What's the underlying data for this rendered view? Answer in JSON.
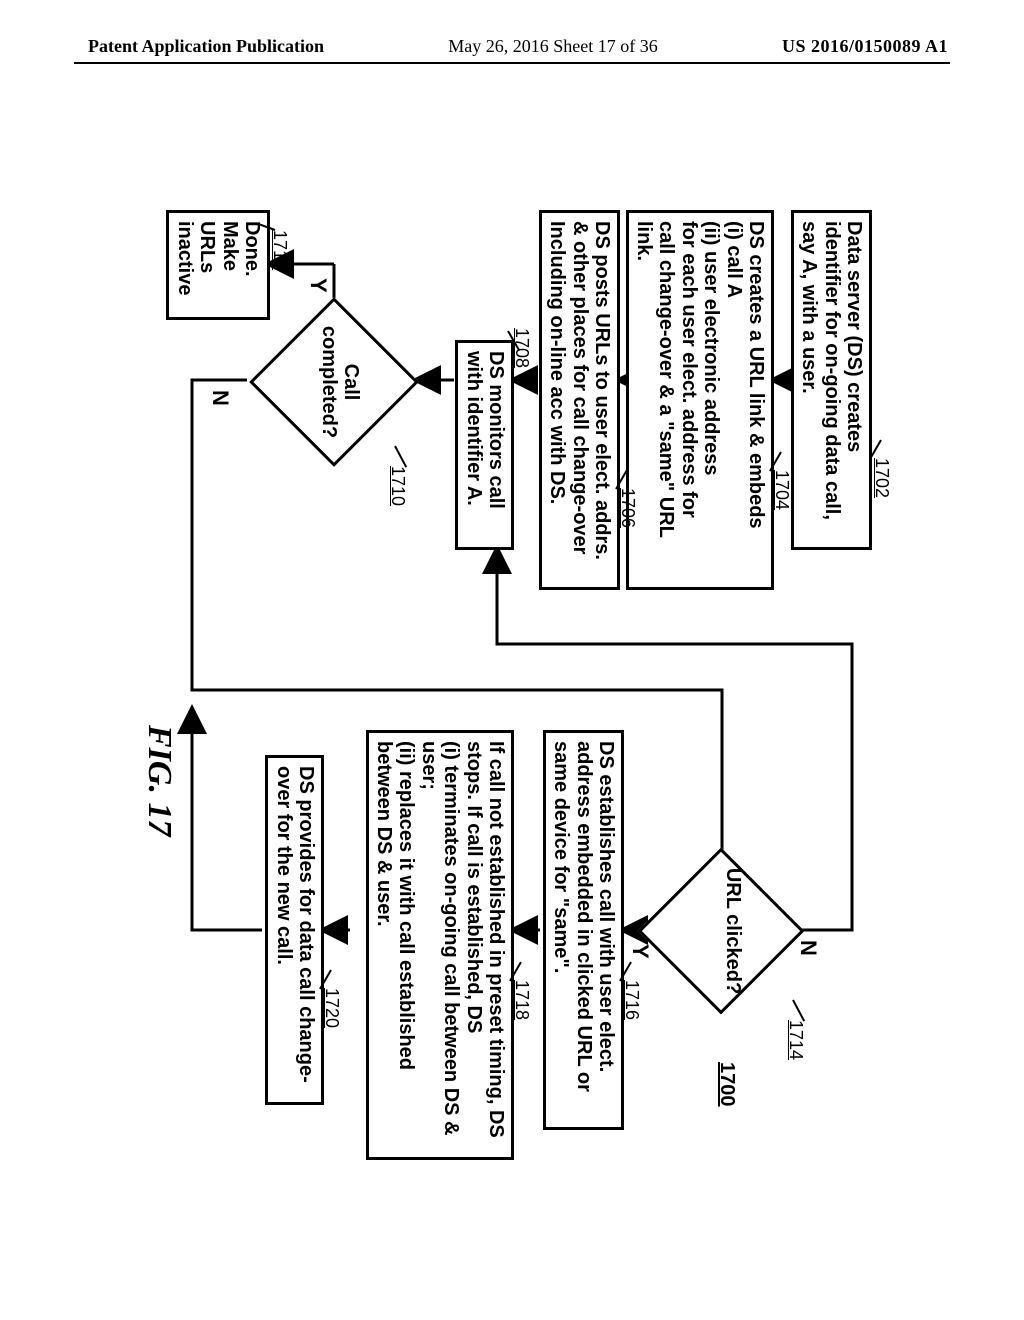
{
  "header": {
    "left": "Patent Application Publication",
    "middle": "May 26, 2016  Sheet 17 of 36",
    "right": "US 2016/0150089 A1"
  },
  "figure_label": "FIG. 17",
  "figure_number_overall": "1700",
  "steps": {
    "s1702": {
      "ref": "1702",
      "text": "Data server (DS) creates identifier for on-going data call, say A, with a user."
    },
    "s1704": {
      "ref": "1704",
      "text": "DS creates a URL link & embeds\n(i) call A\n(ii) user electronic address\nfor each user elect. address for\ncall change-over & a \"same\" URL link."
    },
    "s1706": {
      "ref": "1706",
      "text": "DS posts URLs to user elect. addrs. & other places for call change-over Including on-line acc with DS."
    },
    "s1708": {
      "ref": "1708",
      "text": "DS monitors call with identifier A."
    },
    "s1712": {
      "ref": "1712",
      "text": "Done. Make URLs inactive"
    },
    "s1716": {
      "ref": "1716",
      "text": "DS establishes call with user elect. address embedded in clicked URL or same device for \"same\"."
    },
    "s1718": {
      "ref": "1718",
      "text": "If call not established in preset timing, DS stops.  If call is established, DS\n(i) terminates on-going call between DS & user;\n(ii) replaces it with call established between DS & user."
    },
    "s1720": {
      "ref": "1720",
      "text": "DS provides for data call change-over for the new call."
    }
  },
  "decisions": {
    "d1710": {
      "ref": "1710",
      "label": "Call completed?",
      "yes": "Y",
      "no": "N"
    },
    "d1714": {
      "ref": "1714",
      "label": "URL clicked?",
      "yes": "Y",
      "no": "N"
    }
  },
  "chart_data": {
    "type": "flowchart",
    "title": "FIG. 17",
    "nodes": [
      {
        "id": "1702",
        "shape": "process",
        "text": "Data server (DS) creates identifier for on-going data call, say A, with a user."
      },
      {
        "id": "1704",
        "shape": "process",
        "text": "DS creates a URL link & embeds (i) call A (ii) user electronic address for each user elect. address for call change-over & a \"same\" URL link."
      },
      {
        "id": "1706",
        "shape": "process",
        "text": "DS posts URLs to user elect. addrs. & other places for call change-over Including on-line acc with DS."
      },
      {
        "id": "1708",
        "shape": "process",
        "text": "DS monitors call with identifier A."
      },
      {
        "id": "1710",
        "shape": "decision",
        "text": "Call completed?"
      },
      {
        "id": "1712",
        "shape": "terminator",
        "text": "Done. Make URLs inactive"
      },
      {
        "id": "1714",
        "shape": "decision",
        "text": "URL clicked?"
      },
      {
        "id": "1716",
        "shape": "process",
        "text": "DS establishes call with user elect. address embedded in clicked URL or same device for \"same\"."
      },
      {
        "id": "1718",
        "shape": "process",
        "text": "If call not established in preset timing, DS stops. If call is established, DS (i) terminates on-going call between DS & user; (ii) replaces it with call established between DS & user."
      },
      {
        "id": "1720",
        "shape": "process",
        "text": "DS provides for data call change-over for the new call."
      }
    ],
    "edges": [
      {
        "from": "1702",
        "to": "1704"
      },
      {
        "from": "1704",
        "to": "1706"
      },
      {
        "from": "1706",
        "to": "1708"
      },
      {
        "from": "1708",
        "to": "1710"
      },
      {
        "from": "1710",
        "to": "1712",
        "label": "Y"
      },
      {
        "from": "1710",
        "to": "1714",
        "label": "N"
      },
      {
        "from": "1714",
        "to": "1708",
        "label": "N"
      },
      {
        "from": "1714",
        "to": "1716",
        "label": "Y"
      },
      {
        "from": "1716",
        "to": "1718"
      },
      {
        "from": "1718",
        "to": "1720"
      },
      {
        "from": "1720",
        "to": "1708"
      }
    ]
  }
}
